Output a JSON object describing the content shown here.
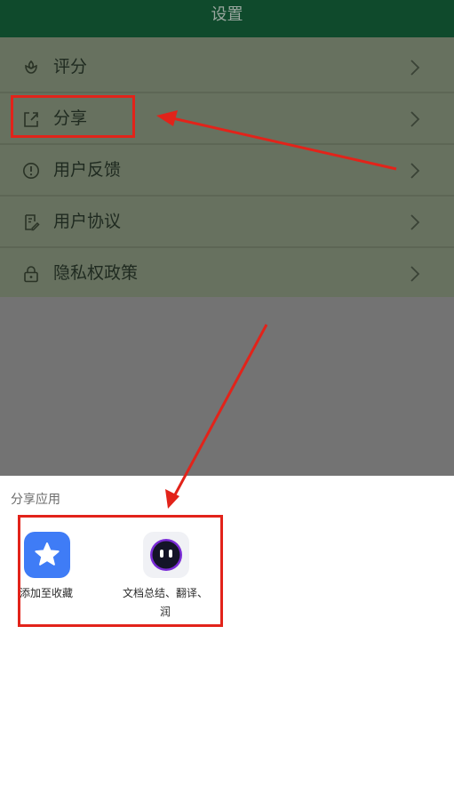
{
  "header": {
    "title": "设置"
  },
  "menu": {
    "items": [
      {
        "label": "评分",
        "icon": "flower-icon"
      },
      {
        "label": "分享",
        "icon": "share-icon"
      },
      {
        "label": "用户反馈",
        "icon": "alert-circle-icon"
      },
      {
        "label": "用户协议",
        "icon": "document-edit-icon"
      },
      {
        "label": "隐私权政策",
        "icon": "lock-icon"
      }
    ]
  },
  "share_sheet": {
    "title": "分享应用",
    "apps": [
      {
        "label": "添加至收藏",
        "icon": "star-icon"
      },
      {
        "label": "文档总结、翻译、润",
        "icon": "ai-assistant-icon"
      }
    ]
  },
  "colors": {
    "topbar": "#0f4a2c",
    "menu_bg": "#67715f",
    "annotation": "#e2231a",
    "star_tile": "#3f7cf6"
  }
}
